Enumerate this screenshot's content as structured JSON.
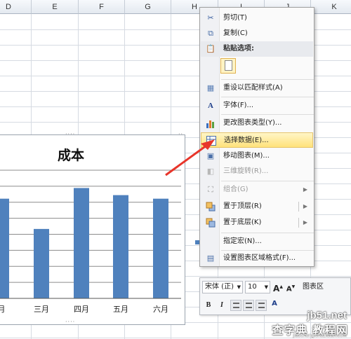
{
  "sheet": {
    "columns": [
      "D",
      "E",
      "F",
      "G",
      "H",
      "I",
      "J",
      "K"
    ]
  },
  "chart_data": {
    "type": "bar",
    "title": "成本",
    "categories": [
      "二月",
      "三月",
      "四月",
      "五月",
      "六月"
    ],
    "category_labels_visible": [
      "月",
      "三月",
      "四月",
      "五月",
      "六月"
    ],
    "values": [
      280,
      195,
      310,
      290,
      280
    ],
    "ylim": [
      0,
      360
    ],
    "grid": true,
    "bar_color": "#4f81bd"
  },
  "context_menu": {
    "items": [
      {
        "icon": "scissors-icon",
        "label": "剪切(T)"
      },
      {
        "icon": "copy-icon",
        "label": "复制(C)"
      },
      {
        "icon": "clipboard-icon",
        "label": "粘贴选项:"
      },
      {
        "icon": "paste-option-icon",
        "label": ""
      },
      {
        "icon": "reset-style-icon",
        "label": "重设以匹配样式(A)"
      },
      {
        "icon": "font-icon",
        "label": "字体(F)..."
      },
      {
        "icon": "chart-type-icon",
        "label": "更改图表类型(Y)..."
      },
      {
        "icon": "select-data-icon",
        "label": "选择数据(E)..."
      },
      {
        "icon": "move-chart-icon",
        "label": "移动图表(M)..."
      },
      {
        "icon": "rotate-3d-icon",
        "label": "三维旋转(R)..."
      },
      {
        "icon": "group-icon",
        "label": "组合(G)"
      },
      {
        "icon": "bring-front-icon",
        "label": "置于顶层(R)"
      },
      {
        "icon": "send-back-icon",
        "label": "置于底层(K)"
      },
      {
        "icon": "macro-icon",
        "label": "指定宏(N)..."
      },
      {
        "icon": "format-chart-area-icon",
        "label": "设置图表区域格式(F)..."
      }
    ]
  },
  "mini_toolbar": {
    "font_name": "宋体 (正)",
    "font_size": "10",
    "grow_font": "A",
    "shrink_font": "A",
    "chart_element": "图表区",
    "bold": "B",
    "italic": "I",
    "font_color_label": "A"
  },
  "watermark": {
    "site": "jb51.net",
    "cn": "查字典 教程网",
    "small": "jiaocheng.chazidian.com"
  },
  "colors": {
    "accent_highlight": "#ffe27a",
    "arrow": "#e8352a",
    "bar": "#4f81bd"
  }
}
